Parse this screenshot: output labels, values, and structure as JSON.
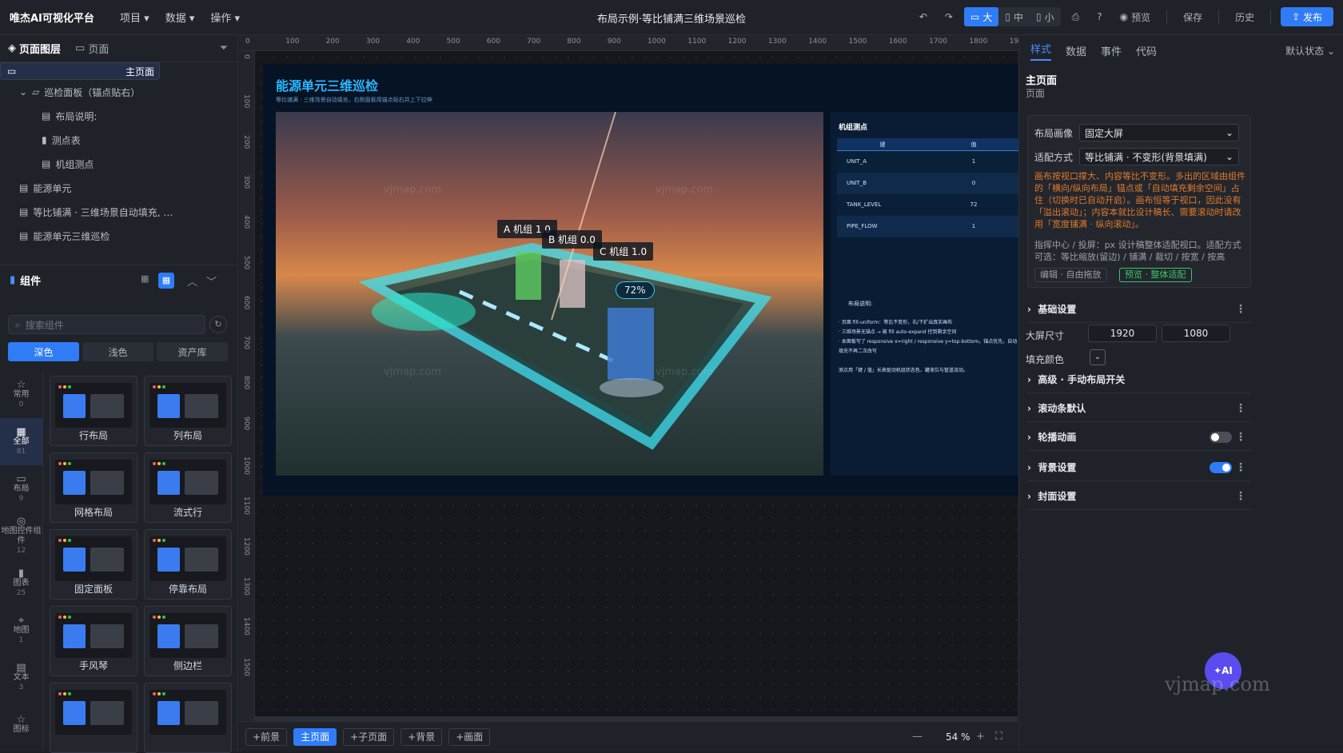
{
  "app": {
    "brand": "唯杰AI可视化平台",
    "doc_title": "布局示例·等比铺满三维场景巡检",
    "menus": [
      "项目",
      "数据",
      "操作"
    ]
  },
  "toolbar": {
    "large": "大",
    "medium": "中",
    "small": "小",
    "preview": "预览",
    "save": "保存",
    "history": "历史",
    "publish": "发布"
  },
  "left": {
    "tabs": [
      "页面图层",
      "页面"
    ],
    "tree": [
      {
        "label": "主页面",
        "level": 0,
        "icon": "monitor-icon"
      },
      {
        "label": "巡检面板（锚点贴右）",
        "level": 1,
        "icon": "folder-icon"
      },
      {
        "label": "布局说明:",
        "level": 2,
        "icon": "file-icon"
      },
      {
        "label": "测点表",
        "level": 2,
        "icon": "bar-chart-icon"
      },
      {
        "label": "机组测点",
        "level": 2,
        "icon": "file-icon"
      },
      {
        "label": "能源单元",
        "level": 1,
        "icon": "file-icon"
      },
      {
        "label": "等比铺满 · 三维场景自动填充, …",
        "level": 1,
        "icon": "file-icon"
      },
      {
        "label": "能源单元三维巡检",
        "level": 1,
        "icon": "file-icon"
      }
    ],
    "components_title": "组件",
    "search_placeholder": "搜索组件",
    "themes": [
      "深色",
      "浅色",
      "资产库"
    ],
    "categories": [
      {
        "label": "常用",
        "count": "0"
      },
      {
        "label": "全部",
        "count": "81"
      },
      {
        "label": "布局",
        "count": "9"
      },
      {
        "label": "地图控件组件",
        "count": "12"
      },
      {
        "label": "图表",
        "count": "25"
      },
      {
        "label": "地图",
        "count": "1"
      },
      {
        "label": "文本",
        "count": "3"
      },
      {
        "label": "图标",
        "count": ""
      }
    ],
    "cards": [
      "行布局",
      "列布局",
      "网格布局",
      "流式行",
      "固定面板",
      "停靠布局",
      "手风琴",
      "侧边栏",
      "",
      ""
    ]
  },
  "canvas": {
    "ruler_top": [
      "0",
      "100",
      "200",
      "300",
      "400",
      "500",
      "600",
      "700",
      "800",
      "900",
      "1000",
      "1100",
      "1200",
      "1300",
      "1400",
      "1500",
      "1600",
      "1700",
      "1800",
      "19"
    ],
    "ruler_left": [
      "0",
      "100",
      "200",
      "300",
      "400",
      "500",
      "600",
      "700",
      "800",
      "900",
      "1000",
      "1100",
      "1200",
      "1300",
      "1400",
      "1500"
    ],
    "board_title": "能源单元三维巡检",
    "board_subtitle": "等比铺满 · 三维场景自动填充，右侧面板用锚点贴右并上下拉伸",
    "labels": [
      "A 机组 1.0",
      "B 机组 0.0",
      "C 机组 1.0"
    ],
    "gauge": "72%",
    "watermark": "vjmap.com",
    "panel_title": "机组测点",
    "table_headers": [
      "键",
      "值"
    ],
    "table_rows": [
      [
        "UNIT_A",
        "1"
      ],
      [
        "UNIT_B",
        "0"
      ],
      [
        "TANK_LEVEL",
        "72"
      ],
      [
        "PIPE_FLOW",
        "1"
      ]
    ],
    "notes_title": "布局说明:",
    "notes": [
      "· 页面 fill-uniform：等比不变形，右/下扩出真实画布",
      "· 三维场景无锚点 → 被 fill auto-expand 控到剩余空间",
      "· 本面板写了 responsive x=right / responsive y=top-bottom，锚点优先，自动填充不再二次改写"
    ],
    "notes_tail": "测点用「键 / 值」长表驱动机组状态色、罐液位与管道流动。"
  },
  "bottom": {
    "buttons": [
      "+前景",
      "主页面",
      "+子页面",
      "+背景",
      "+画面"
    ],
    "zoom": "54",
    "zoom_unit": "%"
  },
  "right": {
    "tabs": [
      "样式",
      "数据",
      "事件",
      "代码"
    ],
    "state": "默认状态",
    "page_title": "主页面",
    "page_sub": "页面",
    "layout_label": "布局画像",
    "layout_value": "固定大屏",
    "fit_label": "适配方式",
    "fit_value": "等比铺满 · 不变形(背景填满)",
    "warning": "画布按视口撑大、内容等比不变形。多出的区域由组件的「横向/纵向布局」锚点或「自动填充剩余空间」占住（切换时已自动开启）。画布恒等于视口，因此没有「溢出滚动」；内容本就比设计稿长、需要滚动时请改用「宽度铺满 · 纵向滚动」。",
    "hint": "指挥中心 / 投屏：px 设计稿整体适配视口。适配方式可选：等比缩放(留边) / 铺满 / 裁切 / 按宽 / 按高",
    "btn_edit": "编辑 · 自由拖放",
    "btn_preview": "预览 · 整体适配",
    "sections": [
      "基础设置",
      "高级 · 手动布局开关",
      "滚动条默认",
      "轮播动画",
      "背景设置",
      "封面设置"
    ],
    "screen_size_label": "大屏尺寸",
    "width": "1920",
    "height": "1080",
    "fill_label": "填充颜色",
    "ai": "AI",
    "watermark": "vjmap.com"
  },
  "colors": {
    "accent": "#2f7cf6",
    "warning": "#e07a2c",
    "success": "#3cc46b"
  }
}
